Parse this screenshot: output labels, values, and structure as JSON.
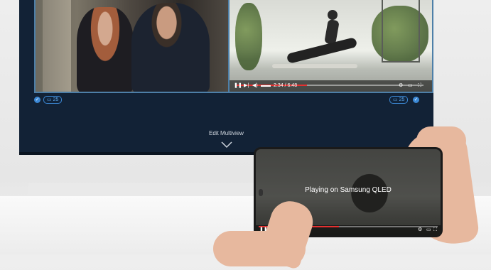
{
  "multiview": {
    "edit_label": "Edit Multiview",
    "left_badge": "25",
    "right_badge": "25",
    "player": {
      "time": "2:34 / 6:48",
      "progress": 0.38
    }
  },
  "phone": {
    "status": "Playing on Samsung QLED",
    "progress": 0.45
  },
  "icons": [
    "play-pause-icon",
    "next-icon",
    "volume-icon",
    "settings-icon",
    "cast-icon",
    "fullscreen-icon",
    "check-icon",
    "chevron-down-icon",
    "phone-screen-icon"
  ],
  "colors": {
    "tv_bg": "#122236",
    "accent": "#3c89d6",
    "progress": "#e53030"
  }
}
